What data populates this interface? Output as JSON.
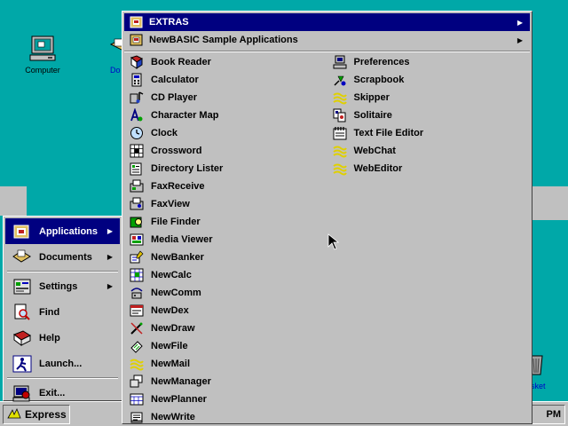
{
  "desktop": {
    "icons": [
      {
        "label": "Computer",
        "icon": "computer-icon"
      },
      {
        "label": "Do",
        "icon": "documents-icon"
      },
      {
        "label": "asket",
        "icon": "wastebasket-icon"
      }
    ]
  },
  "taskbar": {
    "start_label": "Express",
    "clock": "PM"
  },
  "start_menu": {
    "items": [
      {
        "label": "Applications",
        "icon": "applications-icon",
        "has_submenu": true,
        "active": true
      },
      {
        "label": "Documents",
        "icon": "documents-icon",
        "has_submenu": true
      },
      {
        "label": "Settings",
        "icon": "settings-icon",
        "has_submenu": true
      },
      {
        "label": "Find",
        "icon": "find-icon"
      },
      {
        "label": "Help",
        "icon": "help-icon"
      },
      {
        "label": "Launch...",
        "icon": "launch-icon"
      },
      {
        "label": "Exit...",
        "icon": "exit-icon"
      }
    ]
  },
  "submenu": {
    "headers": [
      {
        "label": "EXTRAS",
        "icon": "extras-folder-icon",
        "has_submenu": true,
        "active": true
      },
      {
        "label": "NewBASIC Sample Applications",
        "icon": "sample-folder-icon",
        "has_submenu": true
      }
    ],
    "left_column": [
      {
        "label": "Book Reader",
        "icon": "book-reader-icon"
      },
      {
        "label": "Calculator",
        "icon": "calculator-icon"
      },
      {
        "label": "CD Player",
        "icon": "cd-player-icon"
      },
      {
        "label": "Character Map",
        "icon": "character-map-icon"
      },
      {
        "label": "Clock",
        "icon": "clock-icon"
      },
      {
        "label": "Crossword",
        "icon": "crossword-icon"
      },
      {
        "label": "Directory Lister",
        "icon": "directory-lister-icon"
      },
      {
        "label": "FaxReceive",
        "icon": "fax-receive-icon"
      },
      {
        "label": "FaxView",
        "icon": "fax-view-icon"
      },
      {
        "label": "File Finder",
        "icon": "file-finder-icon"
      },
      {
        "label": "Media Viewer",
        "icon": "media-viewer-icon"
      },
      {
        "label": "NewBanker",
        "icon": "newbanker-icon"
      },
      {
        "label": "NewCalc",
        "icon": "newcalc-icon"
      },
      {
        "label": "NewComm",
        "icon": "newcomm-icon"
      },
      {
        "label": "NewDex",
        "icon": "newdex-icon"
      },
      {
        "label": "NewDraw",
        "icon": "newdraw-icon"
      },
      {
        "label": "NewFile",
        "icon": "newfile-icon"
      },
      {
        "label": "NewMail",
        "icon": "newmail-icon"
      },
      {
        "label": "NewManager",
        "icon": "newmanager-icon"
      },
      {
        "label": "NewPlanner",
        "icon": "newplanner-icon"
      },
      {
        "label": "NewWrite",
        "icon": "newwrite-icon"
      }
    ],
    "right_column": [
      {
        "label": "Preferences",
        "icon": "preferences-icon"
      },
      {
        "label": "Scrapbook",
        "icon": "scrapbook-icon"
      },
      {
        "label": "Skipper",
        "icon": "skipper-icon"
      },
      {
        "label": "Solitaire",
        "icon": "solitaire-icon"
      },
      {
        "label": "Text File Editor",
        "icon": "text-file-editor-icon"
      },
      {
        "label": "WebChat",
        "icon": "webchat-icon"
      },
      {
        "label": "WebEditor",
        "icon": "webeditor-icon"
      }
    ]
  },
  "colors": {
    "desktop": "#00a8a8",
    "chrome": "#c0c0c0",
    "highlight": "#000080",
    "highlight_text": "#ffffff"
  }
}
